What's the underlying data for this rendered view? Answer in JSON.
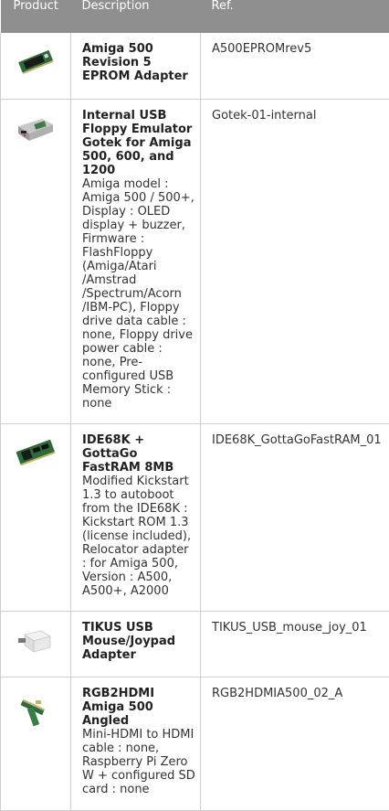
{
  "headers": {
    "product": "Product",
    "description": "Description",
    "ref": "Ref."
  },
  "rows": [
    {
      "name": "Amiga 500 Revision 5 EPROM Adapter",
      "detail": "",
      "ref": "A500EPROMrev5"
    },
    {
      "name": "Internal USB Floppy Emulator Gotek for Amiga 500, 600, and 1200",
      "detail": "Amiga model : Amiga 500 / 500+, Display : OLED display + buzzer, Firmware : FlashFloppy (Amiga/Atari /Amstrad /Spectrum/Acorn /IBM-PC), Floppy drive data cable : none, Floppy drive power cable : none, Pre-configured USB Memory Stick : none",
      "ref": "Gotek-01-internal"
    },
    {
      "name": "IDE68K + GottaGo FastRAM 8MB",
      "detail": "Modified Kickstart 1.3 to autoboot from the IDE68K : Kickstart ROM 1.3 (license included), Relocator adapter : for Amiga 500, Version : A500, A500+, A2000",
      "ref": "IDE68K_GottaGoFastRAM_01"
    },
    {
      "name": "TIKUS USB Mouse/Joypad Adapter",
      "detail": "",
      "ref": "TIKUS_USB_mouse_joy_01"
    },
    {
      "name": "RGB2HDMI Amiga 500 Angled",
      "detail": "Mini-HDMI to HDMI cable : none, Raspberry Pi Zero W + configured SD card : none",
      "ref": "RGB2HDMIA500_02_A"
    }
  ]
}
